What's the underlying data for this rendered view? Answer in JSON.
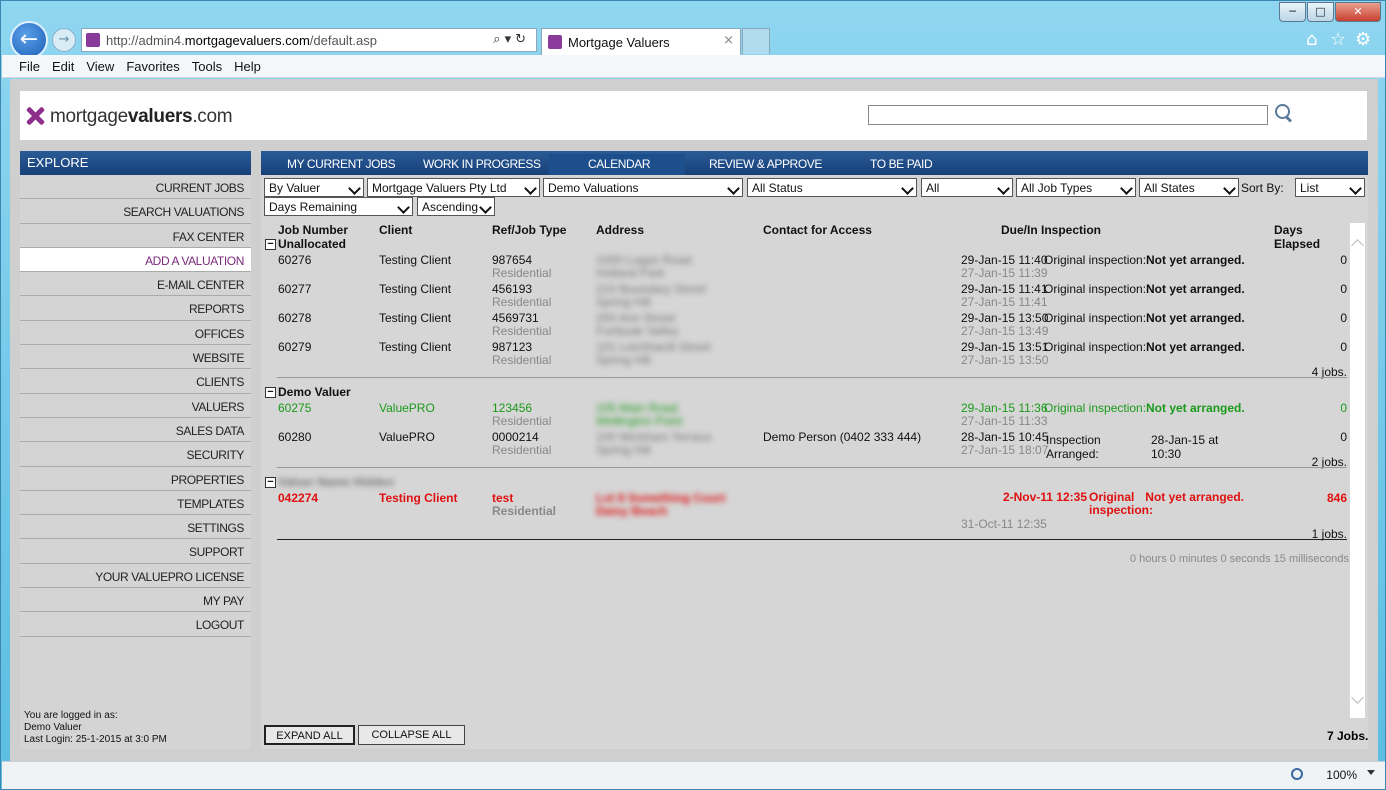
{
  "browser": {
    "url_prefix": "http://admin4.",
    "url_domain": "mortgagevaluers.com",
    "url_path": "/default.asp",
    "tab_title": "Mortgage Valuers",
    "tab_close": "×",
    "menu": [
      "File",
      "Edit",
      "View",
      "Favorites",
      "Tools",
      "Help"
    ],
    "zoom": "100%"
  },
  "header": {
    "logo_light": "mortgage",
    "logo_bold": "valuers",
    "logo_tld": ".com"
  },
  "sidebar": {
    "title": "EXPLORE",
    "items": [
      "CURRENT JOBS",
      "SEARCH VALUATIONS",
      "FAX CENTER",
      "ADD A VALUATION",
      "E-MAIL CENTER",
      "REPORTS",
      "OFFICES",
      "WEBSITE",
      "CLIENTS",
      "VALUERS",
      "SALES DATA",
      "SECURITY",
      "PROPERTIES",
      "TEMPLATES",
      "SETTINGS",
      "SUPPORT",
      "YOUR VALUEPRO LICENSE",
      "MY PAY",
      "LOGOUT"
    ],
    "selected_index": 3,
    "login_line1": "You are logged in as:",
    "login_line2": "Demo Valuer",
    "login_line3": "Last Login: 25-1-2015 at 3:0 PM"
  },
  "tabs": [
    "MY CURRENT JOBS",
    "WORK IN PROGRESS",
    "CALENDAR",
    "REVIEW & APPROVE",
    "TO BE PAID"
  ],
  "active_tab": "CALENDAR",
  "filters": {
    "by": "By Valuer",
    "company": "Mortgage Valuers Pty Ltd",
    "valuations": "Demo Valuations",
    "status": "All Status",
    "all": "All",
    "job_types": "All Job Types",
    "states": "All States",
    "sort_label": "Sort By:",
    "view": "List",
    "days": "Days Remaining",
    "order": "Ascending"
  },
  "columns": {
    "job": "Job Number",
    "client": "Client",
    "ref": "Ref/Job Type",
    "address": "Address",
    "contact": "Contact for Access",
    "due": "Due/In Inspection",
    "elapsed": "Days Elapsed"
  },
  "groups": [
    {
      "name": "Unallocated",
      "summary": "4 jobs.",
      "rows": [
        {
          "job": "60276",
          "client": "Testing Client",
          "ref": "987654",
          "type": "Residential",
          "addr1": "1000 Logan Road",
          "addr2": "Holland Park",
          "contact": "",
          "due": "29-Jan-15 11:40",
          "in": "27-Jan-15 11:39",
          "insp": "Original inspection:",
          "status": "Not yet arranged.",
          "days": "0"
        },
        {
          "job": "60277",
          "client": "Testing Client",
          "ref": "456193",
          "type": "Residential",
          "addr1": "210 Boundary Street",
          "addr2": "Spring Hill",
          "contact": "",
          "due": "29-Jan-15 11:41",
          "in": "27-Jan-15 11:41",
          "insp": "Original inspection:",
          "status": "Not yet arranged.",
          "days": "0"
        },
        {
          "job": "60278",
          "client": "Testing Client",
          "ref": "4569731",
          "type": "Residential",
          "addr1": "200 Ann Street",
          "addr2": "Fortitude Valley",
          "contact": "",
          "due": "29-Jan-15 13:50",
          "in": "27-Jan-15 13:49",
          "insp": "Original inspection:",
          "status": "Not yet arranged.",
          "days": "0"
        },
        {
          "job": "60279",
          "client": "Testing Client",
          "ref": "987123",
          "type": "Residential",
          "addr1": "101 Leichhardt Street",
          "addr2": "Spring Hill",
          "contact": "",
          "due": "29-Jan-15 13:51",
          "in": "27-Jan-15 13:50",
          "insp": "Original inspection:",
          "status": "Not yet arranged.",
          "days": "0"
        }
      ]
    },
    {
      "name": "Demo Valuer",
      "summary": "2 jobs.",
      "rows": [
        {
          "job": "60275",
          "client": "ValuePRO",
          "ref": "123456",
          "type": "Residential",
          "addr1": "105 Main Road",
          "addr2": "Wellington Point",
          "contact": "",
          "due": "29-Jan-15 11:36",
          "in": "27-Jan-15 11:33",
          "insp": "Original inspection:",
          "status": "Not yet arranged.",
          "days": "0"
        },
        {
          "job": "60280",
          "client": "ValuePRO",
          "ref": "0000214",
          "type": "Residential",
          "addr1": "100 Wickham Terrace",
          "addr2": "Spring Hill",
          "contact": "Demo Person (0402 333 444)",
          "due": "28-Jan-15 10:45",
          "in": "27-Jan-15 18:07",
          "insp": "Inspection Arranged:",
          "status": "28-Jan-15 at 10:30",
          "days": "0"
        }
      ]
    },
    {
      "name": "Valuer Name Hidden",
      "summary": "1 jobs.",
      "rows": [
        {
          "job": "042274",
          "client": "Testing Client",
          "ref": "test",
          "type": "Residential",
          "addr1": "Lot 8 Something Court",
          "addr2": "Daisy Beach",
          "contact": "",
          "due": "2-Nov-11 12:35",
          "in": "31-Oct-11 12:35",
          "insp": "Original inspection:",
          "status": "Not yet arranged.",
          "days": "846"
        }
      ]
    }
  ],
  "timing": "0 hours 0 minutes 0 seconds 15 milliseconds",
  "buttons": {
    "expand": "EXPAND ALL",
    "collapse": "COLLAPSE ALL"
  },
  "total": "7 Jobs.",
  "colors": {
    "nav_blue": "#17407a",
    "accent_purple": "#8e2f8c",
    "green": "#1a9a1a",
    "red": "#e01010"
  }
}
